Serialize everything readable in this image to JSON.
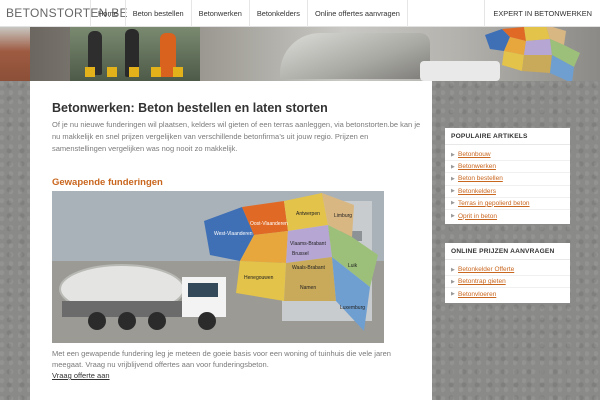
{
  "site": {
    "logo": "BETONSTORTEN.BE"
  },
  "nav": {
    "items": [
      "Home",
      "Beton bestellen",
      "Betonwerken",
      "Betonkelders",
      "Online offertes aanvragen"
    ],
    "right": "EXPERT IN BETONWERKEN"
  },
  "main": {
    "title": "Betonwerken: Beton bestellen en laten storten",
    "intro": "Of je nu nieuwe funderingen wil plaatsen, kelders wil gieten of een terras aanleggen, via betonstorten.be kan je nu makkelijk en snel prijzen vergelijken van verschillende betonfirma’s uit jouw regio. Prijzen en samenstellingen vergelijken was nog nooit zo makkelijk.",
    "section_title": "Gewapende funderingen",
    "map_labels": [
      "Antwerpen",
      "West-Vlaanderen",
      "Oost-Vlaanderen",
      "Vlaams-Brabant",
      "Limburg",
      "Henegouwen",
      "Waals-Brabant",
      "Namen",
      "Luik",
      "Luxemburg",
      "Brussel"
    ],
    "caption": "Met een gewapende fundering leg je meteen de goeie basis voor een woning of tuinhuis die vele jaren meegaat. Vraag nu vrijblijvend offertes aan voor funderingsbeton.",
    "caption_link": "Vraag offerte aan"
  },
  "sidebar": {
    "popular": {
      "title": "POPULAIRE ARTIKELS",
      "items": [
        "Betonbouw",
        "Betonwerken",
        "Beton bestellen",
        "Betonkelders",
        "Terras in gepolierd beton",
        "Oprit in beton"
      ]
    },
    "quotes": {
      "title": "ONLINE PRIJZEN AANVRAGEN",
      "items": [
        "Betonkelder Offerte",
        "Betontrap gieten",
        "Betonvloeren"
      ]
    }
  },
  "colors": {
    "accent": "#c9661e",
    "text": "#333333",
    "muted": "#7a7a7a"
  }
}
